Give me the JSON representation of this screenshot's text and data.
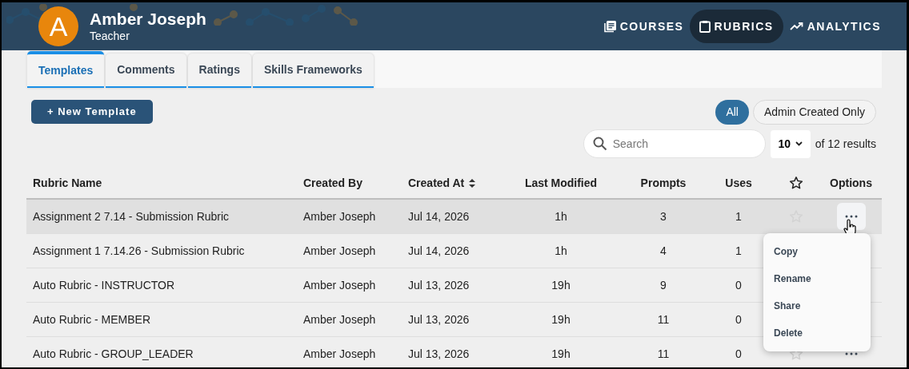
{
  "user": {
    "initial": "A",
    "name": "Amber Joseph",
    "role": "Teacher"
  },
  "nav": [
    {
      "label": "COURSES",
      "selected": false
    },
    {
      "label": "RUBRICS",
      "selected": true
    },
    {
      "label": "ANALYTICS",
      "selected": false
    }
  ],
  "tabs": [
    {
      "label": "Templates",
      "selected": true
    },
    {
      "label": "Comments",
      "selected": false
    },
    {
      "label": "Ratings",
      "selected": false
    },
    {
      "label": "Skills Frameworks",
      "selected": false
    }
  ],
  "new_button": "+ New Template",
  "filters": [
    {
      "label": "All",
      "selected": true
    },
    {
      "label": "Admin Created Only",
      "selected": false
    }
  ],
  "search": {
    "placeholder": "Search"
  },
  "page_size": "10",
  "results": "of 12 results",
  "table": {
    "columns": [
      {
        "label": "Rubric Name",
        "sorted": false
      },
      {
        "label": "Created By",
        "sorted": false
      },
      {
        "label": "Created At",
        "sorted": true
      },
      {
        "label": "Last Modified",
        "sorted": false
      },
      {
        "label": "Prompts",
        "sorted": false
      },
      {
        "label": "Uses",
        "sorted": false
      },
      {
        "kind": "star"
      },
      {
        "label": "Options",
        "sorted": false
      }
    ],
    "rows": [
      {
        "name": "Assignment 2 7.14 - Submission Rubric",
        "created_by": "Amber Joseph",
        "created_at": "Jul 14, 2026",
        "modified": "1h",
        "prompts": "3",
        "uses": "1",
        "hovered": true
      },
      {
        "name": "Assignment 1 7.14.26 - Submission Rubric",
        "created_by": "Amber Joseph",
        "created_at": "Jul 14, 2026",
        "modified": "1h",
        "prompts": "4",
        "uses": "1",
        "hovered": false
      },
      {
        "name": "Auto Rubric - INSTRUCTOR",
        "created_by": "Amber Joseph",
        "created_at": "Jul 13, 2026",
        "modified": "19h",
        "prompts": "9",
        "uses": "0",
        "hovered": false
      },
      {
        "name": "Auto Rubric - MEMBER",
        "created_by": "Amber Joseph",
        "created_at": "Jul 13, 2026",
        "modified": "19h",
        "prompts": "11",
        "uses": "0",
        "hovered": false
      },
      {
        "name": "Auto Rubric - GROUP_LEADER",
        "created_by": "Amber Joseph",
        "created_at": "Jul 13, 2026",
        "modified": "19h",
        "prompts": "11",
        "uses": "0",
        "hovered": false
      }
    ]
  },
  "options_menu": [
    "Copy",
    "Rename",
    "Share",
    "Delete"
  ]
}
